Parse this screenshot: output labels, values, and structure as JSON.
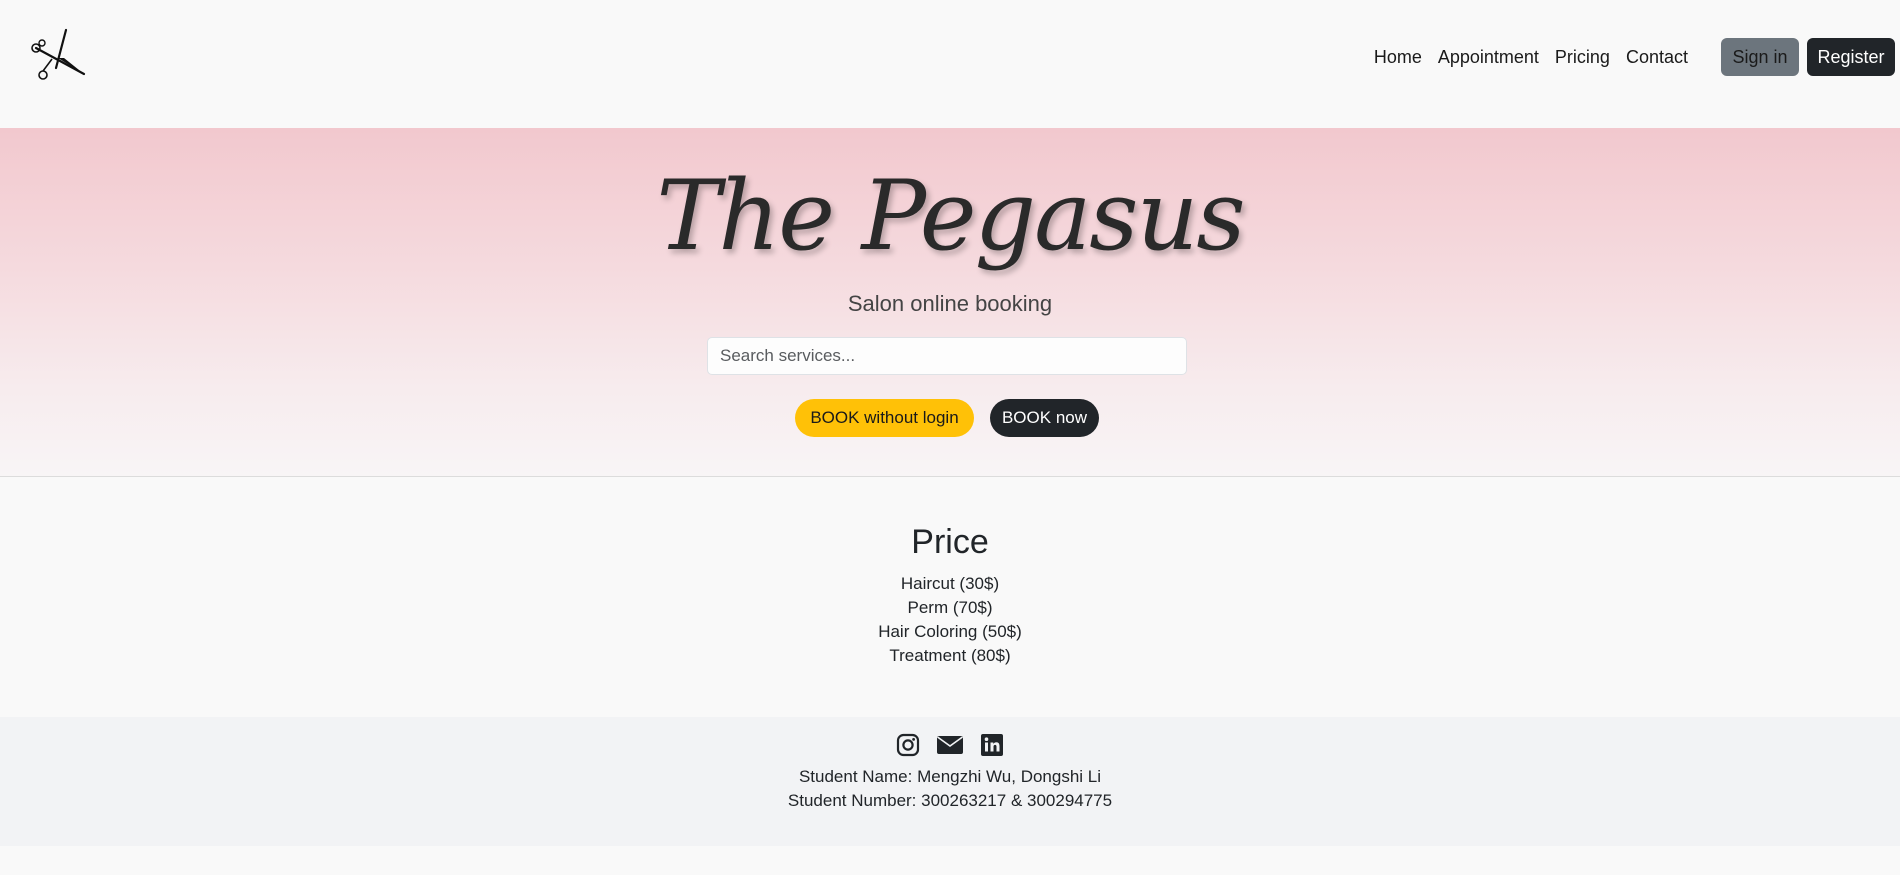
{
  "brand": {
    "logo_icon": "scissors-icon"
  },
  "nav": {
    "links": [
      {
        "label": "Home"
      },
      {
        "label": "Appointment"
      },
      {
        "label": "Pricing"
      },
      {
        "label": "Contact"
      }
    ],
    "signin_label": "Sign in",
    "register_label": "Register"
  },
  "hero": {
    "title": "The Pegasus",
    "subtitle": "Salon online booking",
    "search_placeholder": "Search services...",
    "book_guest_label": "BOOK without login",
    "book_now_label": "BOOK now"
  },
  "price": {
    "title": "Price",
    "items": [
      {
        "label": "Haircut (30$)"
      },
      {
        "label": "Perm (70$)"
      },
      {
        "label": "Hair Coloring (50$)"
      },
      {
        "label": "Treatment (80$)"
      }
    ]
  },
  "footer": {
    "social_icons": [
      "instagram-icon",
      "envelope-icon",
      "linkedin-icon"
    ],
    "student_names": "Student Name: Mengzhi Wu, Dongshi Li",
    "student_numbers": "Student Number: 300263217 & 300294775"
  },
  "colors": {
    "accent_yellow": "#ffc107",
    "dark": "#212529",
    "secondary": "#6c757d",
    "hero_pink": "#f2c8ce"
  }
}
